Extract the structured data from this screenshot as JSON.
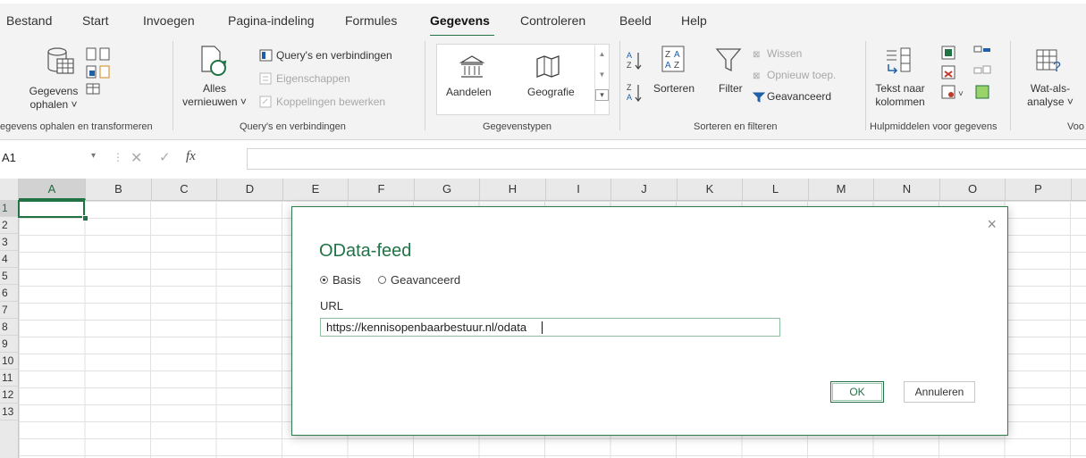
{
  "tabs": [
    "Bestand",
    "Start",
    "Invoegen",
    "Pagina-indeling",
    "Formules",
    "Gegevens",
    "Controleren",
    "Beeld",
    "Help"
  ],
  "ribbon": {
    "get_data": {
      "line1": "Gegevens",
      "line2": "ophalen ˅",
      "group": "egevens ophalen en transformeren"
    },
    "refresh": {
      "line1": "Alles",
      "line2": "vernieuwen ˅"
    },
    "queries": {
      "item1": "Query's en verbindingen",
      "item2": "Eigenschappen",
      "item3": "Koppelingen bewerken",
      "group": "Query's en verbindingen"
    },
    "datatypes": {
      "item1": "Aandelen",
      "item2": "Geografie",
      "group": "Gegevenstypen"
    },
    "sort": {
      "sort_label": "Sorteren",
      "filter_label": "Filter",
      "clear": "Wissen",
      "reapply": "Opnieuw toep.",
      "advanced": "Geavanceerd",
      "group": "Sorteren en filteren"
    },
    "tools": {
      "line1": "Tekst naar",
      "line2": "kolommen",
      "group": "Hulpmiddelen voor gegevens"
    },
    "whatif": {
      "line1": "Wat-als-",
      "line2": "analyse ˅",
      "group": "Voo"
    }
  },
  "formula_bar": {
    "name_box": "A1",
    "fx": "fx"
  },
  "columns": [
    "A",
    "B",
    "C",
    "D",
    "E",
    "F",
    "G",
    "H",
    "I",
    "J",
    "K",
    "L",
    "M",
    "N",
    "O",
    "P"
  ],
  "rows": [
    "1",
    "2",
    "3",
    "4",
    "5",
    "6",
    "7",
    "8",
    "9",
    "10",
    "11",
    "12",
    "13"
  ],
  "dialog": {
    "close": "×",
    "title": "OData-feed",
    "radio_basic": "Basis",
    "radio_advanced": "Geavanceerd",
    "url_label": "URL",
    "url_value": "https://kennisopenbaarbestuur.nl/odata",
    "ok": "OK",
    "cancel": "Annuleren"
  },
  "colors": {
    "accent": "#217346"
  }
}
